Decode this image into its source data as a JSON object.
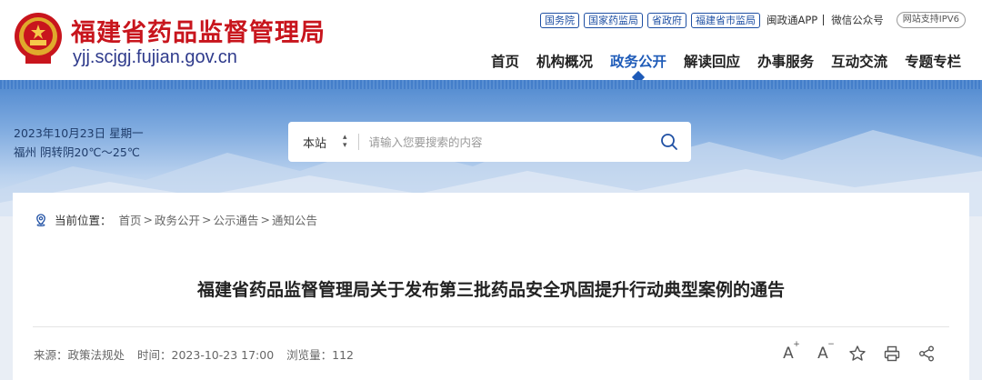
{
  "header": {
    "site_title": "福建省药品监督管理局",
    "site_domain": "yjj.scjgj.fujian.gov.cn",
    "top_links": [
      "国务院",
      "国家药监局",
      "省政府",
      "福建省市监局"
    ],
    "app_link": "闽政通APP",
    "wechat_link": "微信公众号",
    "ipv6_badge": "网站支持IPV6",
    "nav": [
      {
        "label": "首页",
        "active": false
      },
      {
        "label": "机构概况",
        "active": false
      },
      {
        "label": "政务公开",
        "active": true
      },
      {
        "label": "解读回应",
        "active": false
      },
      {
        "label": "办事服务",
        "active": false
      },
      {
        "label": "互动交流",
        "active": false
      },
      {
        "label": "专题专栏",
        "active": false
      }
    ]
  },
  "banner": {
    "date": "2023年10月23日 星期一",
    "weather": "福州 阴转阴20℃～25℃"
  },
  "search": {
    "scope": "本站",
    "placeholder": "请输入您要搜索的内容"
  },
  "breadcrumb": {
    "label": "当前位置：",
    "items": [
      "首页",
      "政务公开",
      "公示通告",
      "通知公告"
    ],
    "separator": ">"
  },
  "article": {
    "title": "福建省药品监督管理局关于发布第三批药品安全巩固提升行动典型案例的通告",
    "source": "来源：政策法规处",
    "time": "时间：2023-10-23 17:00",
    "views": "浏览量：112"
  },
  "tools": {
    "font_increase": "A",
    "font_decrease": "A",
    "increase_mark": "+",
    "decrease_mark": "−"
  },
  "colors": {
    "brand_red": "#c8151d",
    "nav_active": "#1e5bb8",
    "link_blue": "#1e4fa3"
  }
}
